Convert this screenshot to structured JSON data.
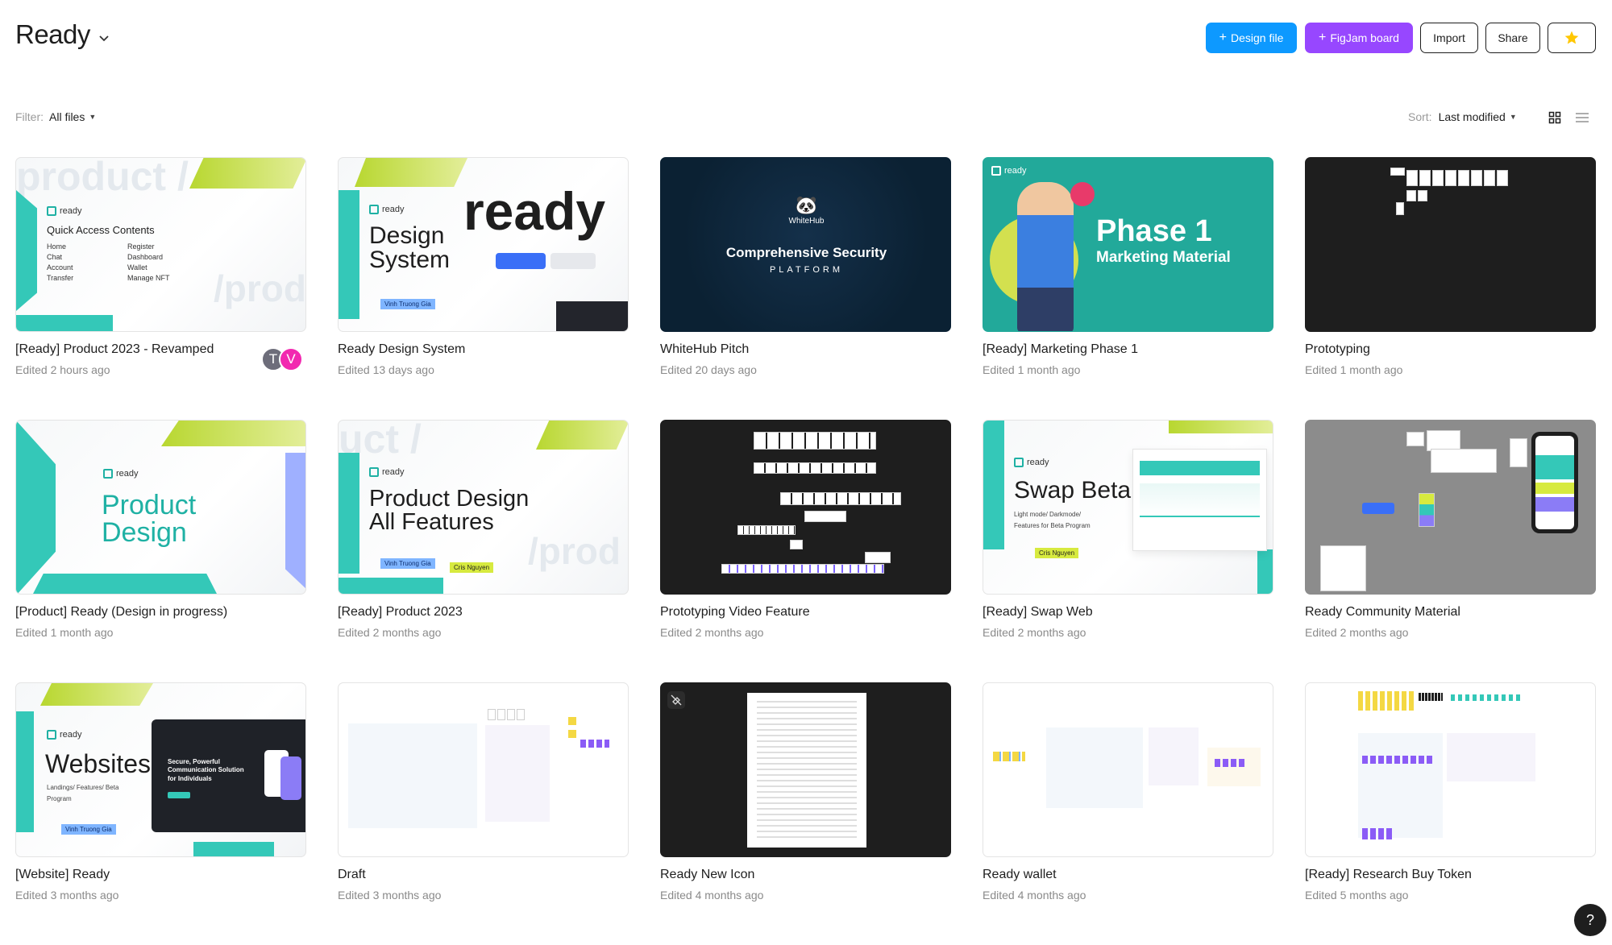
{
  "header": {
    "title": "Ready",
    "buttons": {
      "design_file": "Design file",
      "figjam_board": "FigJam board",
      "import": "Import",
      "share": "Share"
    }
  },
  "filter": {
    "label": "Filter:",
    "value": "All files"
  },
  "sort": {
    "label": "Sort:",
    "value": "Last modified"
  },
  "files": [
    {
      "name": "[Ready] Product 2023 - Revamped",
      "meta": "Edited 2 hours ago",
      "avatars": [
        "T",
        "V"
      ]
    },
    {
      "name": "Ready Design System",
      "meta": "Edited 13 days ago"
    },
    {
      "name": "WhiteHub Pitch",
      "meta": "Edited 20 days ago"
    },
    {
      "name": "[Ready] Marketing Phase 1",
      "meta": "Edited 1 month ago"
    },
    {
      "name": "Prototyping",
      "meta": "Edited 1 month ago"
    },
    {
      "name": "[Product] Ready (Design in progress)",
      "meta": "Edited 1 month ago"
    },
    {
      "name": "[Ready] Product 2023",
      "meta": "Edited 2 months ago"
    },
    {
      "name": "Prototyping Video Feature",
      "meta": "Edited 2 months ago"
    },
    {
      "name": "[Ready] Swap Web",
      "meta": "Edited 2 months ago"
    },
    {
      "name": "Ready Community Material",
      "meta": "Edited 2 months ago"
    },
    {
      "name": "[Website] Ready",
      "meta": "Edited 3 months ago"
    },
    {
      "name": "Draft",
      "meta": "Edited 3 months ago"
    },
    {
      "name": "Ready New Icon",
      "meta": "Edited 4 months ago"
    },
    {
      "name": "Ready wallet",
      "meta": "Edited 4 months ago"
    },
    {
      "name": "[Ready] Research Buy Token",
      "meta": "Edited 5 months ago"
    }
  ],
  "thumbs": {
    "t1": {
      "ghost": "product /",
      "ghost2": "/prod",
      "logo": "ready",
      "heading": "Quick Access Contents",
      "items": [
        "Home",
        "Register",
        "Chat",
        "Dashboard",
        "Account",
        "Wallet",
        "Transfer",
        "Manage NFT"
      ]
    },
    "t2": {
      "ghost": "ready",
      "logo": "ready",
      "heading": "Design System",
      "chip": "Vinh Truong Gia"
    },
    "t3": {
      "brand": "WhiteHub",
      "headline": "Comprehensive Security",
      "sub": "PLATFORM"
    },
    "t4": {
      "logo": "ready",
      "headline": "Phase 1",
      "sub": "Marketing Material"
    },
    "t6": {
      "logo": "ready",
      "heading": "Product Design"
    },
    "t7": {
      "ghost": "uct /",
      "ghost2": "/prod",
      "logo": "ready",
      "heading": "Product Design All Features",
      "chip": "Vinh Truong Gia",
      "chip2": "Cris Nguyen"
    },
    "t9": {
      "logo": "ready",
      "heading": "Swap Beta",
      "sub": "Light mode/ Darkmode/ Features for Beta Program",
      "chip": "Cris Nguyen"
    },
    "t11": {
      "logo": "ready",
      "heading": "Websites",
      "sub": "Landings/ Features/ Beta Program",
      "promo": "Secure, Powerful Communication Solution for Individuals",
      "chip": "Vinh Truong Gia"
    }
  },
  "colors": {
    "primary": "#0d99ff",
    "figjam": "#9747ff",
    "teal": "#34c8b8",
    "lime": "#c8e04a",
    "star": "#ffc700",
    "avatar_pink": "#f228b0"
  },
  "icons": {
    "title_dropdown": "chevron-down-icon",
    "star": "star-icon",
    "grid_view": "grid-view-icon",
    "list_view": "list-view-icon",
    "help": "help-icon",
    "unlinked": "no-link-icon"
  },
  "help": {
    "label": "?"
  }
}
